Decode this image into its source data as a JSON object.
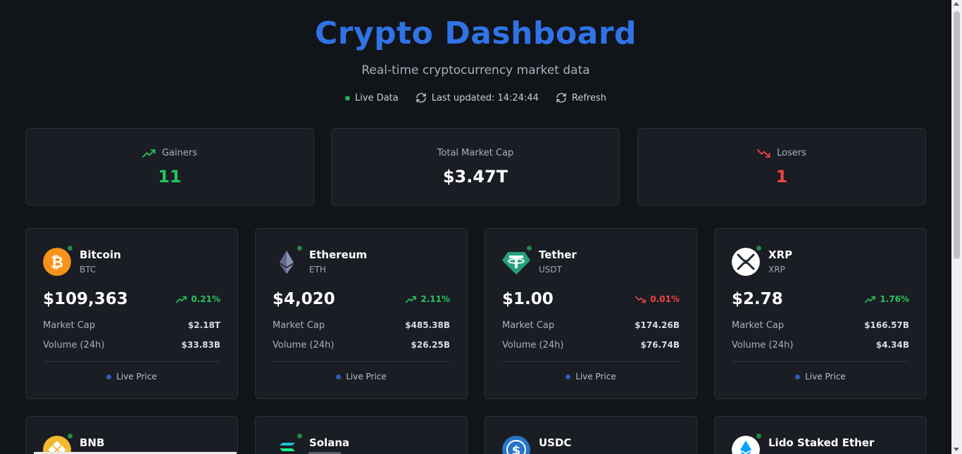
{
  "header": {
    "title": "Crypto Dashboard",
    "subtitle": "Real-time cryptocurrency market data",
    "live_label": "Live Data",
    "last_updated": "Last updated: 14:24:44",
    "refresh_label": "Refresh"
  },
  "summary": {
    "gainers_label": "Gainers",
    "gainers_value": "11",
    "market_cap_label": "Total Market Cap",
    "market_cap_value": "$3.47T",
    "losers_label": "Losers",
    "losers_value": "1"
  },
  "labels": {
    "market_cap": "Market Cap",
    "volume": "Volume (24h)",
    "live_price": "Live Price"
  },
  "coins": [
    {
      "name": "Bitcoin",
      "symbol": "BTC",
      "price": "$109,363",
      "change": "0.21%",
      "direction": "up",
      "market_cap": "$2.18T",
      "volume": "$33.83B",
      "icon": "bitcoin-icon",
      "color": "#f7931a"
    },
    {
      "name": "Ethereum",
      "symbol": "ETH",
      "price": "$4,020",
      "change": "2.11%",
      "direction": "up",
      "market_cap": "$485.38B",
      "volume": "$26.25B",
      "icon": "ethereum-icon",
      "color": "#627eea"
    },
    {
      "name": "Tether",
      "symbol": "USDT",
      "price": "$1.00",
      "change": "0.01%",
      "direction": "down",
      "market_cap": "$174.26B",
      "volume": "$76.74B",
      "icon": "tether-icon",
      "color": "#26a17b"
    },
    {
      "name": "XRP",
      "symbol": "XRP",
      "price": "$2.78",
      "change": "1.76%",
      "direction": "up",
      "market_cap": "$166.57B",
      "volume": "$4.34B",
      "icon": "xrp-icon",
      "color": "#ffffff"
    },
    {
      "name": "BNB",
      "icon": "bnb-icon",
      "color": "#f3ba2f"
    },
    {
      "name": "Solana",
      "icon": "solana-icon",
      "color": "#14f195"
    },
    {
      "name": "USDC",
      "icon": "usdc-icon",
      "color": "#2775ca"
    },
    {
      "name": "Lido Staked Ether",
      "icon": "lido-icon",
      "color": "#00a3ff"
    }
  ],
  "colors": {
    "accent": "#2f73e6",
    "gain": "#23c45e",
    "loss": "#ef4444",
    "background": "#111419",
    "card": "#1a1d23"
  }
}
